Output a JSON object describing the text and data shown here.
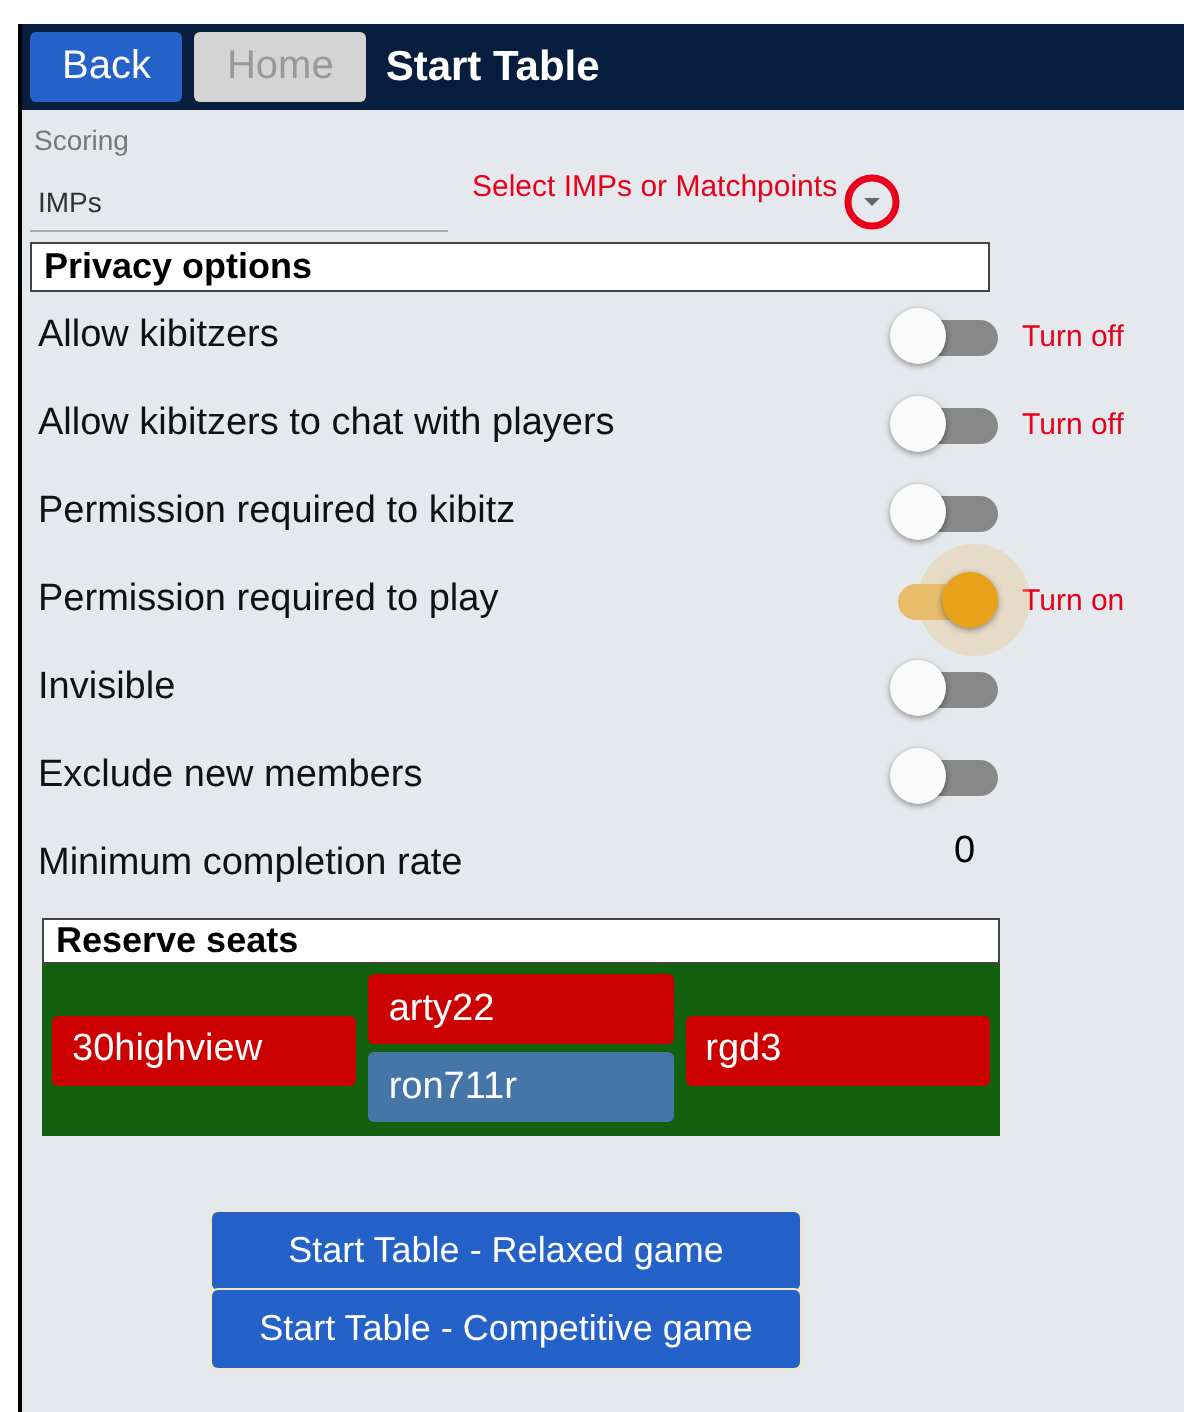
{
  "header": {
    "buttons": [
      {
        "label": "Back",
        "disabled": false
      },
      {
        "label": "Home",
        "disabled": true
      }
    ],
    "title": "Start Table"
  },
  "scoring": {
    "label": "Scoring",
    "value": "IMPs",
    "annotation": "Select IMPs or Matchpoints"
  },
  "privacy": {
    "heading": "Privacy options",
    "options": [
      {
        "label": "Allow kibitzers",
        "on": false,
        "annotation": "Turn off"
      },
      {
        "label": "Allow kibitzers to chat with players",
        "on": false,
        "annotation": "Turn off"
      },
      {
        "label": "Permission required to kibitz",
        "on": false
      },
      {
        "label": "Permission required to play",
        "on": true,
        "annotation": "Turn on"
      },
      {
        "label": "Invisible",
        "on": false
      },
      {
        "label": "Exclude new members",
        "on": false
      }
    ],
    "min_rate": {
      "label": "Minimum completion rate",
      "value": "0"
    }
  },
  "reserve_seats": {
    "heading": "Reserve seats",
    "seats": [
      {
        "name": "30highview",
        "color": "#cc0000"
      },
      {
        "name": "arty22",
        "color": "#cc0000"
      },
      {
        "name": "ron711r",
        "color": "#4675a8"
      },
      {
        "name": "rgd3",
        "color": "#cc0000"
      }
    ]
  },
  "actions": [
    "Start Table - Relaxed game",
    "Start Table - Competitive game"
  ]
}
